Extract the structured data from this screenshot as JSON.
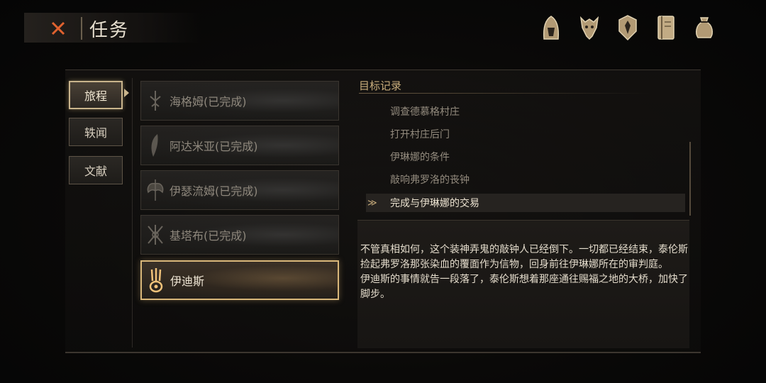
{
  "header": {
    "title": "任务",
    "close_icon": "x-mark-icon"
  },
  "top_icons": [
    {
      "name": "hood-icon"
    },
    {
      "name": "beast-skull-icon"
    },
    {
      "name": "shield-crest-icon"
    },
    {
      "name": "journal-book-icon"
    },
    {
      "name": "pouch-bag-icon"
    }
  ],
  "tabs": [
    {
      "label": "旅程",
      "active": true
    },
    {
      "label": "轶闻",
      "active": false
    },
    {
      "label": "文献",
      "active": false
    }
  ],
  "quests": [
    {
      "label": "海格姆(已完成)",
      "icon": "rune-glyph-icon",
      "active": false
    },
    {
      "label": "阿达米亚(已完成)",
      "icon": "feather-blade-icon",
      "active": false
    },
    {
      "label": "伊瑟流姆(已完成)",
      "icon": "winged-axe-icon",
      "active": false
    },
    {
      "label": "基塔布(已完成)",
      "icon": "crossed-rune-icon",
      "active": false
    },
    {
      "label": "伊迪斯",
      "icon": "flame-crest-icon",
      "active": true
    }
  ],
  "objectives": {
    "title": "目标记录",
    "items": [
      {
        "text": "调查德慕格村庄",
        "current": false
      },
      {
        "text": "打开村庄后门",
        "current": false
      },
      {
        "text": "伊琳娜的条件",
        "current": false
      },
      {
        "text": "敲响弗罗洛的丧钟",
        "current": false
      },
      {
        "text": "完成与伊琳娜的交易",
        "current": true
      }
    ],
    "current_marker": "≫"
  },
  "description": {
    "p1": "不管真相如何，这个装神弄鬼的敲钟人已经倒下。一切都已经结束，泰伦斯捡起弗罗洛那张染血的覆面作为信物，回身前往伊琳娜所在的审判庭。",
    "p2": "伊迪斯的事情就告一段落了，泰伦斯想着那座通往赐福之地的大桥，加快了脚步。"
  },
  "colors": {
    "accent": "#d9b77a",
    "close": "#e0622f"
  }
}
